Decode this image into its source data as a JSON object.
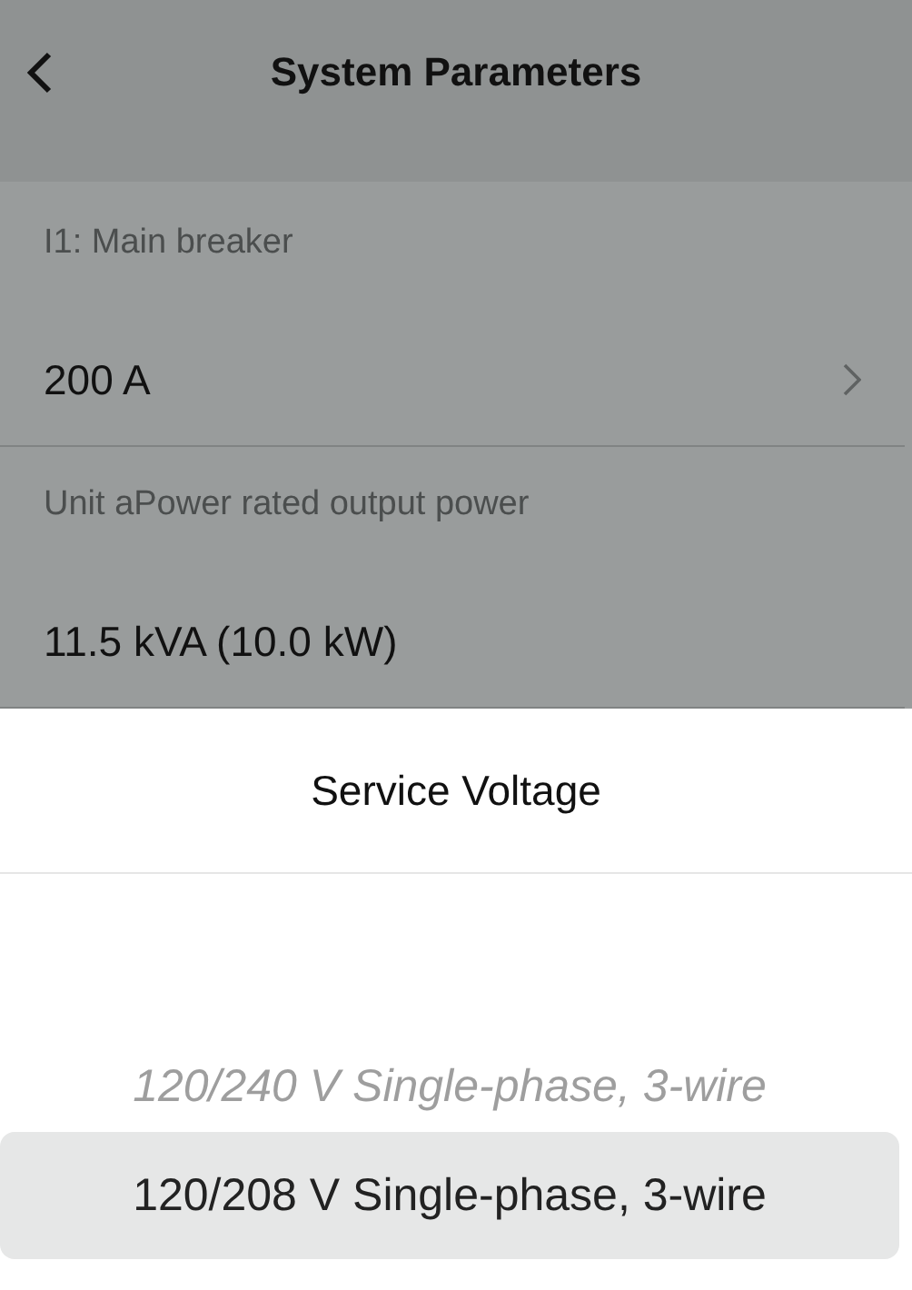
{
  "header": {
    "title": "System Parameters"
  },
  "parameters": [
    {
      "label": "I1: Main breaker",
      "value": "200 A",
      "has_chevron": true
    },
    {
      "label": "Unit aPower rated output power",
      "value": "11.5 kVA (10.0 kW)",
      "has_chevron": false
    }
  ],
  "sheet": {
    "title": "Service Voltage",
    "options": [
      {
        "label": "120/240 V Single-phase, 3-wire",
        "selected": false
      },
      {
        "label": "120/208 V Single-phase, 3-wire",
        "selected": true
      }
    ]
  }
}
